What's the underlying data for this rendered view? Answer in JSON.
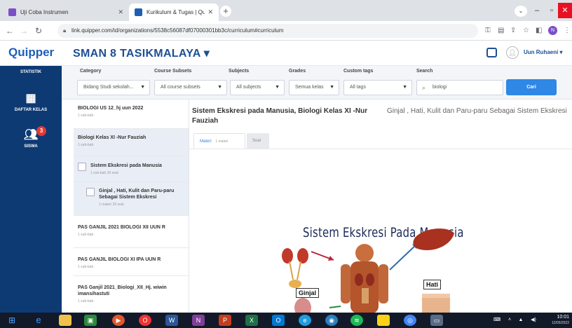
{
  "browser": {
    "tabs": [
      {
        "title": "Uji Coba Instrumen",
        "active": false,
        "favicon_color": "#7b4fc9"
      },
      {
        "title": "Kurikulum & Tugas | Quipper Sch",
        "active": true,
        "favicon_color": "#1d5fb4"
      }
    ],
    "new_tab": "+",
    "url": "link.quipper.com/id/organizations/5538c56087df07000301bb3c/curriculum#curriculum",
    "profile_initial": "N"
  },
  "header": {
    "logo": "Quipper",
    "school": "SMAN 8 TASIKMALAYA ▾",
    "user_name": "Uun Ruhaeni ▾"
  },
  "sidebar": {
    "items": [
      {
        "label": "STATISTIK"
      },
      {
        "label": "DAFTAR KELAS",
        "icon": "class-list-icon"
      },
      {
        "label": "SISWA",
        "icon": "students-icon",
        "badge": "3"
      }
    ]
  },
  "filters": {
    "labels": {
      "category": "Category",
      "course_subsets": "Course Subsets",
      "subjects": "Subjects",
      "grades": "Grades",
      "custom_tags": "Custom tags",
      "search": "Search"
    },
    "values": {
      "category": "Bidang Studi sekolah...",
      "course_subsets": "All course subsets",
      "subjects": "All subjects",
      "grades": "Semua kelas",
      "custom_tags": "All tags",
      "search": "biologi"
    },
    "search_button": "Cari"
  },
  "course_list": [
    {
      "title": "BIOLOGI US 12_hj uun 2022",
      "sub": "1 sub-bab",
      "selected": false
    },
    {
      "title": "Biologi Kelas XI -Nur Fauziah",
      "sub": "1 sub-bab",
      "selected": true
    },
    {
      "title": "Sistem Ekskresi pada Manusia",
      "sub": "1 sub-bab  29 soal",
      "selected": true
    },
    {
      "title": "Ginjal , Hati, Kulit dan Paru-paru Sebagai Sistem Ekskresi",
      "sub": "1 materi  29 soal",
      "selected": true
    },
    {
      "title": "PAS GANJIL 2021 BIOLOGI XII UUN R",
      "sub": "1 sub-bab",
      "selected": false
    },
    {
      "title": "PAS GANJIL BIOLOGI XI IPA UUN R",
      "sub": "1 sub-bab",
      "selected": false
    },
    {
      "title": "PAS Ganjil 2021_Biologi_XII_Hj. wiwin imansihastuti",
      "sub": "1 sub-bab",
      "selected": false
    }
  ],
  "main": {
    "title": "Sistem Ekskresi pada Manusia, Biologi Kelas XI -Nur Fauziah",
    "right_title": "Ginjal , Hati, Kulit dan Paru-paru Sebagai Sistem Ekskresi",
    "tabs": {
      "materi": "Materi",
      "materi_count": "1 materi",
      "soal": "Soal"
    },
    "slide": {
      "title": "Sistem Ekskresi Pada Manusia",
      "label_ginjal": "Ginjal",
      "label_hati": "Hati"
    }
  },
  "taskbar": {
    "time": "10:01",
    "date": "12/05/2022"
  }
}
